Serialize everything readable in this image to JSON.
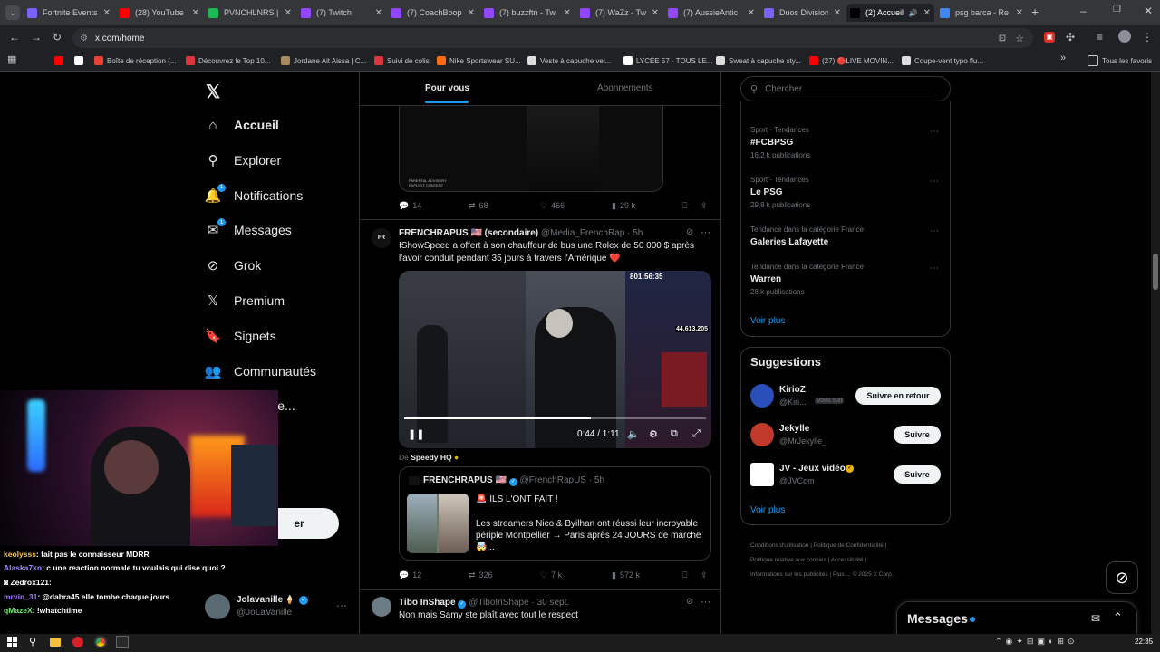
{
  "browser": {
    "tabs": [
      {
        "title": "Fortnite Events",
        "favicon_color": "#7b61ff"
      },
      {
        "title": "(28) YouTube",
        "favicon_color": "#ff0000"
      },
      {
        "title": "PVNCHLNRS |",
        "favicon_color": "#1db954"
      },
      {
        "title": "(7) Twitch",
        "favicon_color": "#9146ff"
      },
      {
        "title": "(7) CoachBoop",
        "favicon_color": "#9146ff"
      },
      {
        "title": "(7) buzzftn - Tw",
        "favicon_color": "#9146ff"
      },
      {
        "title": "(7) WaZz - Twit",
        "favicon_color": "#9146ff"
      },
      {
        "title": "(7) AussieAntic",
        "favicon_color": "#9146ff"
      },
      {
        "title": "Duos Division",
        "favicon_color": "#7b61ff"
      },
      {
        "title": "(2) Accueil",
        "favicon_color": "#000000"
      },
      {
        "title": "psg barca - Re",
        "favicon_color": "#4285f4"
      }
    ],
    "url": "x.com/home",
    "bookmarks": [
      {
        "label": "",
        "color": "#ff0000"
      },
      {
        "label": "",
        "color": "#ffffff"
      },
      {
        "label": "Boîte de réception (...",
        "color": "#ea4335"
      },
      {
        "label": "Découvrez le Top 10...",
        "color": "#d9363e"
      },
      {
        "label": "Jordane Ait Aissa | C...",
        "color": "#a58b5e"
      },
      {
        "label": "Suivi de colis",
        "color": "#d9363e"
      },
      {
        "label": "Nike Sportswear SU...",
        "color": "#ff6a13"
      },
      {
        "label": "Veste à capuche vel...",
        "color": "#dddddd"
      },
      {
        "label": "LYCÉE 57 - TOUS LE...",
        "color": "#ffffff"
      },
      {
        "label": "Sweat à capuche sty...",
        "color": "#dddddd"
      },
      {
        "label": "(27) 🔴LIVE MOVIN...",
        "color": "#ff0000"
      },
      {
        "label": "Coupe-vent typo flu...",
        "color": "#dddddd"
      }
    ],
    "all_bookmarks": "Tous les favoris"
  },
  "nav": {
    "items": [
      {
        "label": "Accueil",
        "icon": "home-icon",
        "glyph": "⌂"
      },
      {
        "label": "Explorer",
        "icon": "search-icon",
        "glyph": "⚲"
      },
      {
        "label": "Notifications",
        "icon": "bell-icon",
        "glyph": "🔔"
      },
      {
        "label": "Messages",
        "icon": "mail-icon",
        "glyph": "✉"
      },
      {
        "label": "Grok",
        "icon": "grok-icon",
        "glyph": "⊘"
      },
      {
        "label": "Premium",
        "icon": "x-icon",
        "glyph": "𝕏"
      },
      {
        "label": "Signets",
        "icon": "bookmark-icon",
        "glyph": "🔖"
      },
      {
        "label": "Communautés",
        "icon": "people-icon",
        "glyph": "👥"
      },
      {
        "label": "ations ce...",
        "icon": "",
        "glyph": ""
      }
    ],
    "notif_badge": "1",
    "msg_badge": "1",
    "post_button_fragment": "er",
    "account": {
      "name": "Jolavanille",
      "handle": "@JoLaVanille"
    }
  },
  "feed": {
    "tabs": [
      "Pour vous",
      "Abonnements"
    ],
    "top_post": {
      "explicit": "PARENTAL ADVISORY EXPLICIT CONTENT",
      "replies": "14",
      "reposts": "68",
      "likes": "466",
      "views": "29 k"
    },
    "post": {
      "author": "FRENCHRAPUS 🇺🇸 (secondaire)",
      "handle": "@Media_FrenchRap",
      "time": "5h",
      "text": "IShowSpeed a offert à son chauffeur de bus une Rolex de 50 000 $ après l'avoir conduit pendant 35 jours à travers l'Amérique ❤️",
      "video_counter": "801:56:35",
      "video_viewers": "44,613,205",
      "video_time": "0:44 / 1:11",
      "video_progress": 0.62,
      "source_prefix": "De",
      "source": "Speedy HQ",
      "replies": "12",
      "reposts": "326",
      "likes": "7 k",
      "views": "572 k",
      "quote": {
        "author": "FRENCHRAPUS 🇺🇸",
        "handle": "@FrenchRapUS",
        "time": "5h",
        "headline": "🚨 ILS L'ONT FAIT !",
        "text": "Les streamers Nico & Byilhan ont réussi leur incroyable périple Montpellier → Paris après 24 JOURS de marche 🤯..."
      }
    },
    "next_post": {
      "author": "Tibo InShape",
      "handle": "@TiboInShape",
      "time": "30 sept.",
      "text": "Non mais Samy ste plaît avec tout le respect"
    }
  },
  "right": {
    "search_placeholder": "Chercher",
    "trends": [
      {
        "category": "Sport · Tendances",
        "name": "#FCBPSG",
        "count": "16,2 k publications"
      },
      {
        "category": "Sport · Tendances",
        "name": "Le PSG",
        "count": "29,8 k publications"
      },
      {
        "category": "Tendance dans la catégorie France",
        "name": "Galeries Lafayette",
        "count": ""
      },
      {
        "category": "Tendance dans la catégorie France",
        "name": "Warren",
        "count": "28 k publications"
      }
    ],
    "show_more": "Voir plus",
    "suggestions_title": "Suggestions",
    "suggestions": [
      {
        "name": "KirioZ",
        "handle": "@Kiri...",
        "follows_you": "Vous suit",
        "button": "Suivre en retour"
      },
      {
        "name": "Jekylle",
        "handle": "@MrJekylle_",
        "follows_you": "",
        "button": "Suivre"
      },
      {
        "name": "JV - Jeux vidéo",
        "handle": "@JVCom",
        "follows_you": "",
        "button": "Suivre"
      }
    ],
    "suggestions_more": "Voir plus",
    "footer": [
      "Conditions d'utilisation",
      "Politique de Confidentialité",
      "Politique relative aux cookies",
      "Accessibilité",
      "Informations sur les publicités",
      "Plus ...",
      "© 2025 X Corp."
    ],
    "messages_label": "Messages"
  },
  "chat": [
    {
      "user": "keolysss",
      "color": "#f5c542",
      "text": ": fait pas le connaisseur MDRR"
    },
    {
      "user": "Alaska7kn",
      "color": "#9b8cff",
      "text": ": c une reaction normale tu voulais qui dise quoi ?"
    },
    {
      "user": "Zedrox121",
      "color": "#ffffff",
      "text": ":"
    },
    {
      "user": "mrvin_31",
      "color": "#a37bff",
      "text": ": @dabra45 elle tombe chaque jours"
    },
    {
      "user": "qMazeX",
      "color": "#6ef06e",
      "text": ": !whatchtime"
    }
  ],
  "taskbar": {
    "time": "22:35"
  }
}
